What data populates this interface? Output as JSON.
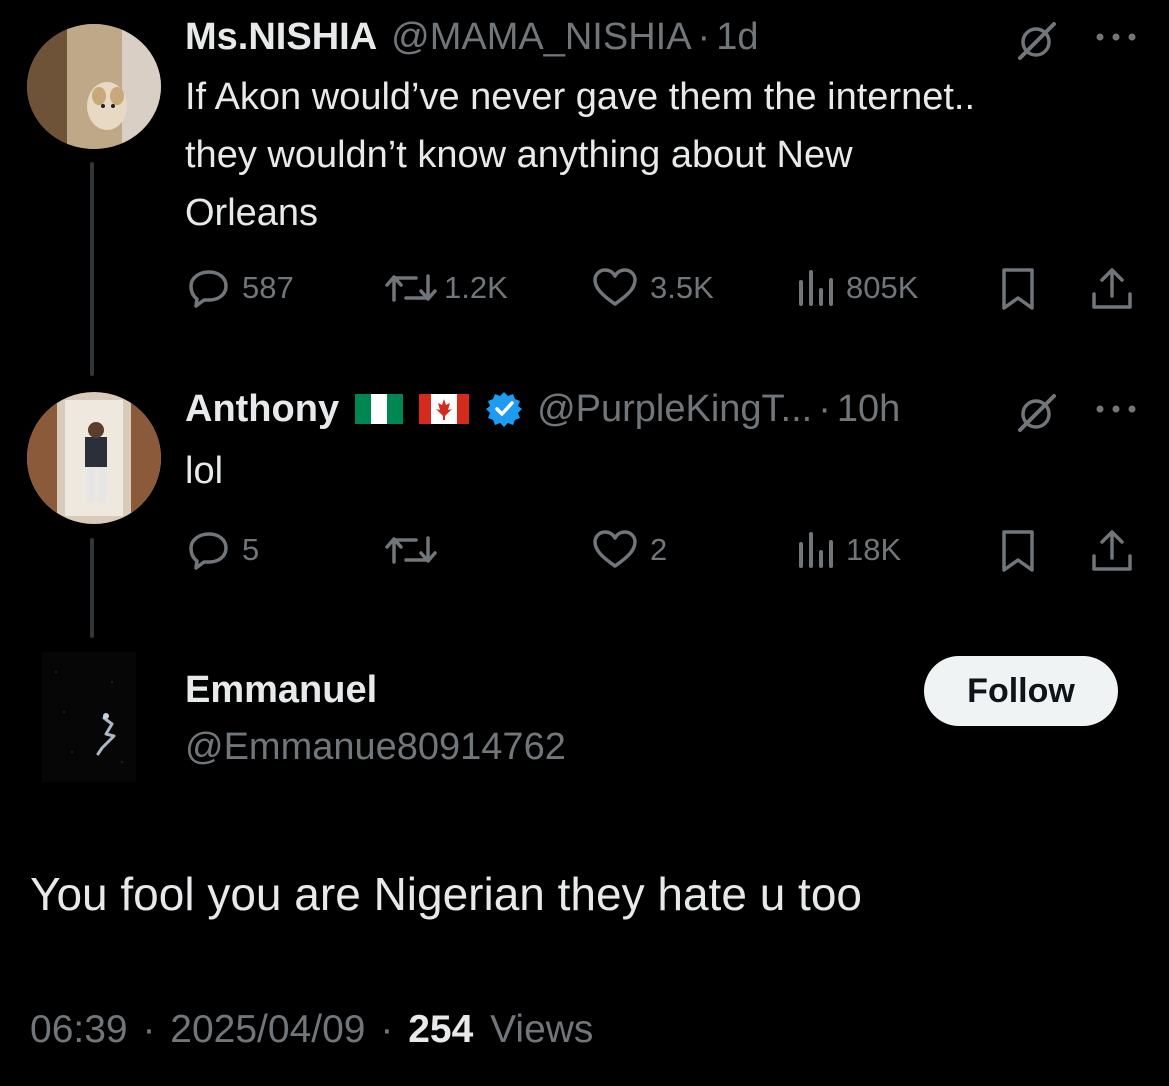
{
  "tweets": [
    {
      "name": "Ms.NISHIA",
      "handle": "@MAMA_NISHIA",
      "time": "1d",
      "text_lines": [
        "If Akon would’ve never gave them the internet..",
        "they wouldn’t know anything about New",
        "Orleans"
      ],
      "replies": "587",
      "reposts": "1.2K",
      "likes": "3.5K",
      "views": "805K"
    },
    {
      "name": "Anthony",
      "flags": [
        "nigeria-flag",
        "canada-flag"
      ],
      "verified": true,
      "handle": "@PurpleKingT...",
      "time": "10h",
      "text_lines": [
        "lol"
      ],
      "replies": "5",
      "reposts": "",
      "likes": "2",
      "views": "18K"
    }
  ],
  "main_post": {
    "name": "Emmanuel",
    "handle": "@Emmanue80914762",
    "follow_label": "Follow",
    "text": "You fool you are Nigerian they hate u too",
    "time": "06:39",
    "date": "2025/04/09",
    "views_count": "254",
    "views_label": "Views"
  },
  "separator": "·",
  "icons": {
    "reply": "reply-icon",
    "repost": "repost-icon",
    "like": "heart-icon",
    "views": "analytics-icon",
    "bookmark": "bookmark-icon",
    "share": "share-icon",
    "grok": "grok-icon",
    "more": "more-icon",
    "verified": "verified-badge-icon"
  },
  "colors": {
    "background": "#000000",
    "text_primary": "#e7e9ea",
    "text_secondary": "#71767b",
    "verified_blue": "#1d9bf0",
    "follow_bg": "#eff3f4"
  }
}
